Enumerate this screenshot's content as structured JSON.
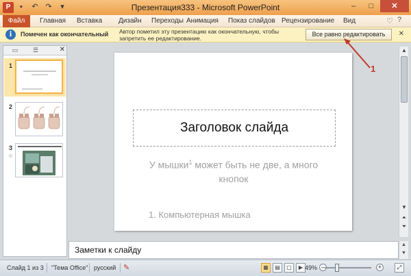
{
  "app": {
    "icon_letter": "P",
    "window_title": "Презентация333  -  Microsoft PowerPoint"
  },
  "quick_access": {
    "save_icon": "save-icon",
    "undo_icon": "undo-icon",
    "redo_icon": "redo-icon"
  },
  "window_controls": {
    "minimize": "–",
    "maximize": "□",
    "close": "✕"
  },
  "ribbon": {
    "file_tab": "Файл",
    "tabs": [
      "Главная",
      "Вставка",
      "Дизайн",
      "Переходы",
      "Анимация",
      "Показ слайдов",
      "Рецензирование",
      "Вид"
    ]
  },
  "infobar": {
    "title": "Помечен как окончательный",
    "message": "Автор пометил эту презентацию как окончательную, чтобы запретить ее редактирование.",
    "button_label": "Все равно редактировать",
    "close": "✕"
  },
  "slide_panel": {
    "thumbnails": [
      {
        "number": "1",
        "selected": true
      },
      {
        "number": "2",
        "selected": false
      },
      {
        "number": "3",
        "selected": false,
        "has_animation_star": true
      }
    ]
  },
  "slide": {
    "title": "Заголовок слайда",
    "subtitle_part1": "У мышки",
    "subtitle_sup": "1",
    "subtitle_part2": " может быть не две, а много кнопок",
    "footnote": "1. Компьютерная мышка"
  },
  "notes": {
    "placeholder": "Заметки к слайду"
  },
  "statusbar": {
    "slide_info": "Слайд 1 из 3",
    "theme": "\"Тема Office\"",
    "language": "русский",
    "zoom": "49%"
  },
  "annotation": {
    "label": "1",
    "color": "#c0392b"
  }
}
